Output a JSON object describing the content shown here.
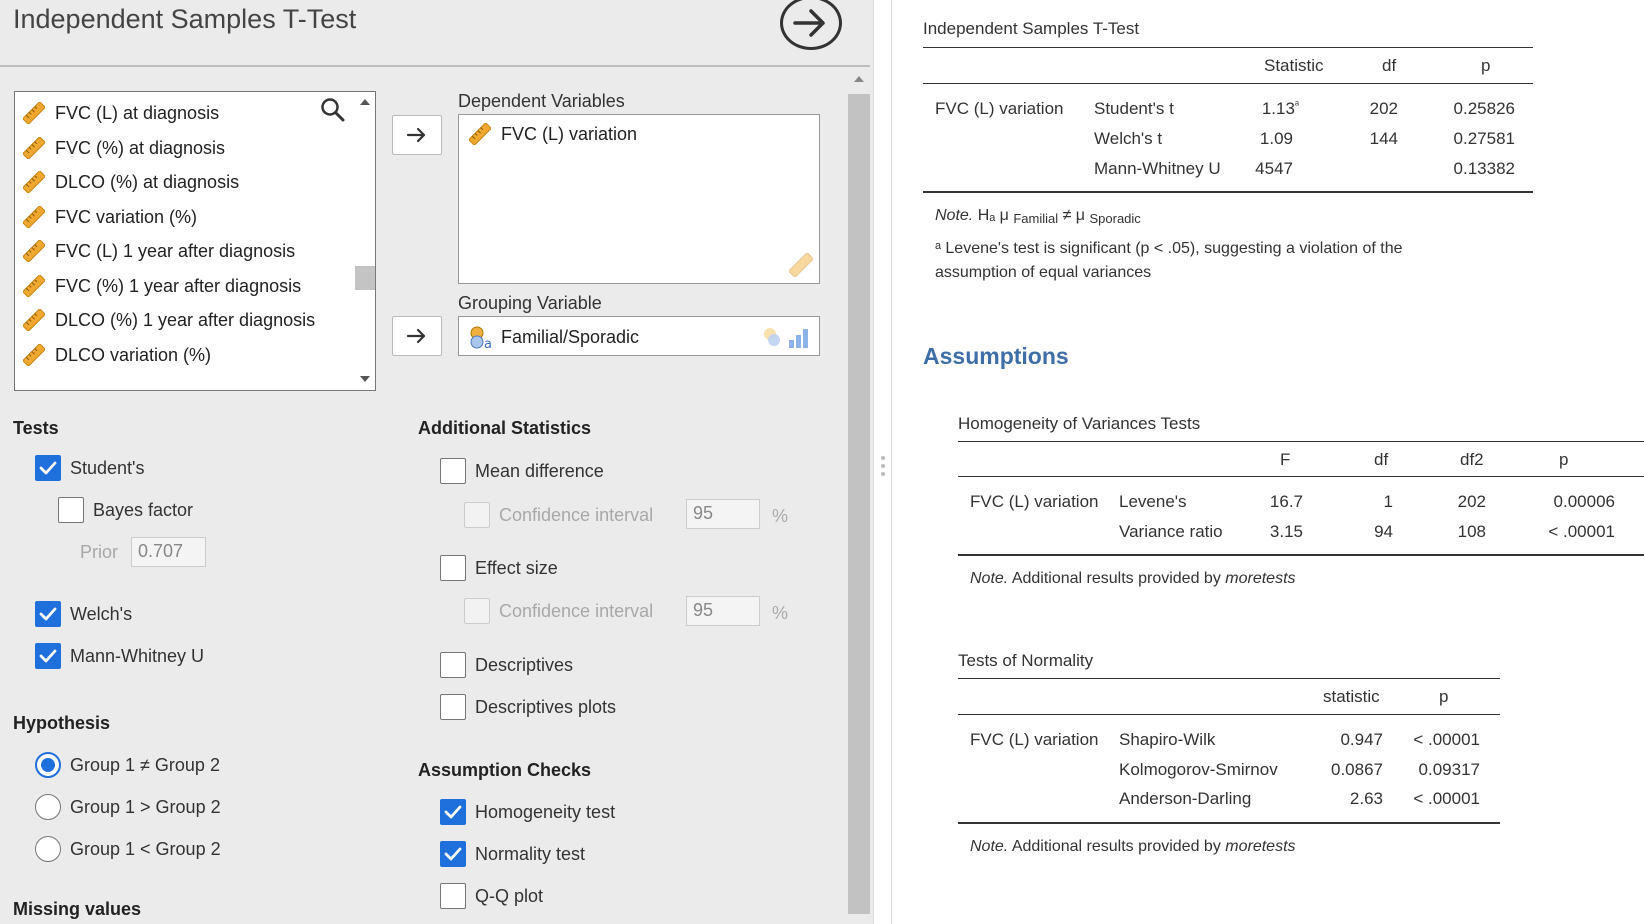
{
  "analysis": {
    "title": "Independent Samples T-Test"
  },
  "variables": {
    "available": [
      "FVC (L) at diagnosis",
      "FVC (%) at diagnosis",
      "DLCO (%) at diagnosis",
      "FVC variation (%)",
      "FVC (L) 1 year after diagnosis",
      "FVC (%) 1 year after diagnosis",
      "DLCO (%) 1 year after diagnosis",
      "DLCO variation (%)"
    ],
    "dependent_label": "Dependent Variables",
    "dependent": [
      "FVC (L) variation"
    ],
    "grouping_label": "Grouping Variable",
    "grouping": "Familial/Sporadic"
  },
  "tests": {
    "title": "Tests",
    "students": {
      "label": "Student's",
      "checked": true
    },
    "bayes": {
      "label": "Bayes factor",
      "checked": false
    },
    "prior": {
      "label": "Prior",
      "value": "0.707"
    },
    "welchs": {
      "label": "Welch's",
      "checked": true
    },
    "mann_whitney": {
      "label": "Mann-Whitney U",
      "checked": true
    }
  },
  "hypothesis": {
    "title": "Hypothesis",
    "options": [
      {
        "label": "Group 1 ≠ Group 2",
        "selected": true
      },
      {
        "label": "Group 1 > Group 2",
        "selected": false
      },
      {
        "label": "Group 1 < Group 2",
        "selected": false
      }
    ]
  },
  "missing": {
    "title": "Missing values"
  },
  "additional": {
    "title": "Additional Statistics",
    "mean_diff": {
      "label": "Mean difference",
      "checked": false
    },
    "ci1": {
      "label": "Confidence interval",
      "value": "95",
      "unit": "%"
    },
    "effect": {
      "label": "Effect size",
      "checked": false
    },
    "ci2": {
      "label": "Confidence interval",
      "value": "95",
      "unit": "%"
    },
    "descriptives": {
      "label": "Descriptives",
      "checked": false
    },
    "desc_plots": {
      "label": "Descriptives plots",
      "checked": false
    }
  },
  "assumption_checks": {
    "title": "Assumption Checks",
    "homogeneity": {
      "label": "Homogeneity test",
      "checked": true
    },
    "normality": {
      "label": "Normality test",
      "checked": true
    },
    "qq": {
      "label": "Q-Q plot",
      "checked": false
    }
  },
  "results": {
    "ttest": {
      "title": "Independent Samples T-Test",
      "headers": [
        "Statistic",
        "df",
        "p"
      ],
      "variable": "FVC (L) variation",
      "rows": [
        {
          "test": "Student's t",
          "statistic": "1.13",
          "mark": "ᵃ",
          "df": "202",
          "p": "0.25826"
        },
        {
          "test": "Welch's t",
          "statistic": "1.09",
          "mark": "",
          "df": "144",
          "p": "0.27581"
        },
        {
          "test": "Mann-Whitney U",
          "statistic": "4547",
          "mark": "",
          "df": "",
          "p": "0.13382"
        }
      ],
      "note_label": "Note.",
      "note_h": "Hₐ μ",
      "note_g1": "Familial",
      "note_neq": "≠ μ",
      "note_g2": "Sporadic",
      "footnote_1": "ᵃ Levene's test is significant (p < .05), suggesting a violation of the",
      "footnote_2": "assumption of equal variances"
    },
    "assumptions_heading": "Assumptions",
    "homogeneity": {
      "title": "Homogeneity of Variances Tests",
      "headers": [
        "F",
        "df",
        "df2",
        "p"
      ],
      "variable": "FVC (L) variation",
      "rows": [
        {
          "test": "Levene's",
          "F": "16.7",
          "df": "1",
          "df2": "202",
          "p": "0.00006"
        },
        {
          "test": "Variance ratio",
          "F": "3.15",
          "df": "94",
          "df2": "108",
          "p": "< .00001"
        }
      ],
      "note_label": "Note.",
      "note_text": "Additional results provided by",
      "note_pkg": "moretests"
    },
    "normality": {
      "title": "Tests of Normality",
      "headers": [
        "statistic",
        "p"
      ],
      "variable": "FVC (L) variation",
      "rows": [
        {
          "test": "Shapiro-Wilk",
          "statistic": "0.947",
          "p": "< .00001"
        },
        {
          "test": "Kolmogorov-Smirnov",
          "statistic": "0.0867",
          "p": "0.09317"
        },
        {
          "test": "Anderson-Darling",
          "statistic": "2.63",
          "p": "< .00001"
        }
      ],
      "note_label": "Note.",
      "note_text": "Additional results provided by",
      "note_pkg": "moretests"
    }
  },
  "colors": {
    "accent": "#1f6fdd",
    "heading": "#3e6da8",
    "ruler_icon": "#f0a830",
    "panel_bg": "#ebebeb"
  },
  "icons": {
    "run": "arrow-right-circle-icon",
    "search": "search-icon",
    "continuous": "ruler-icon",
    "nominal": "nominal-variable-icon",
    "move": "arrow-right-icon",
    "check": "check-icon"
  }
}
